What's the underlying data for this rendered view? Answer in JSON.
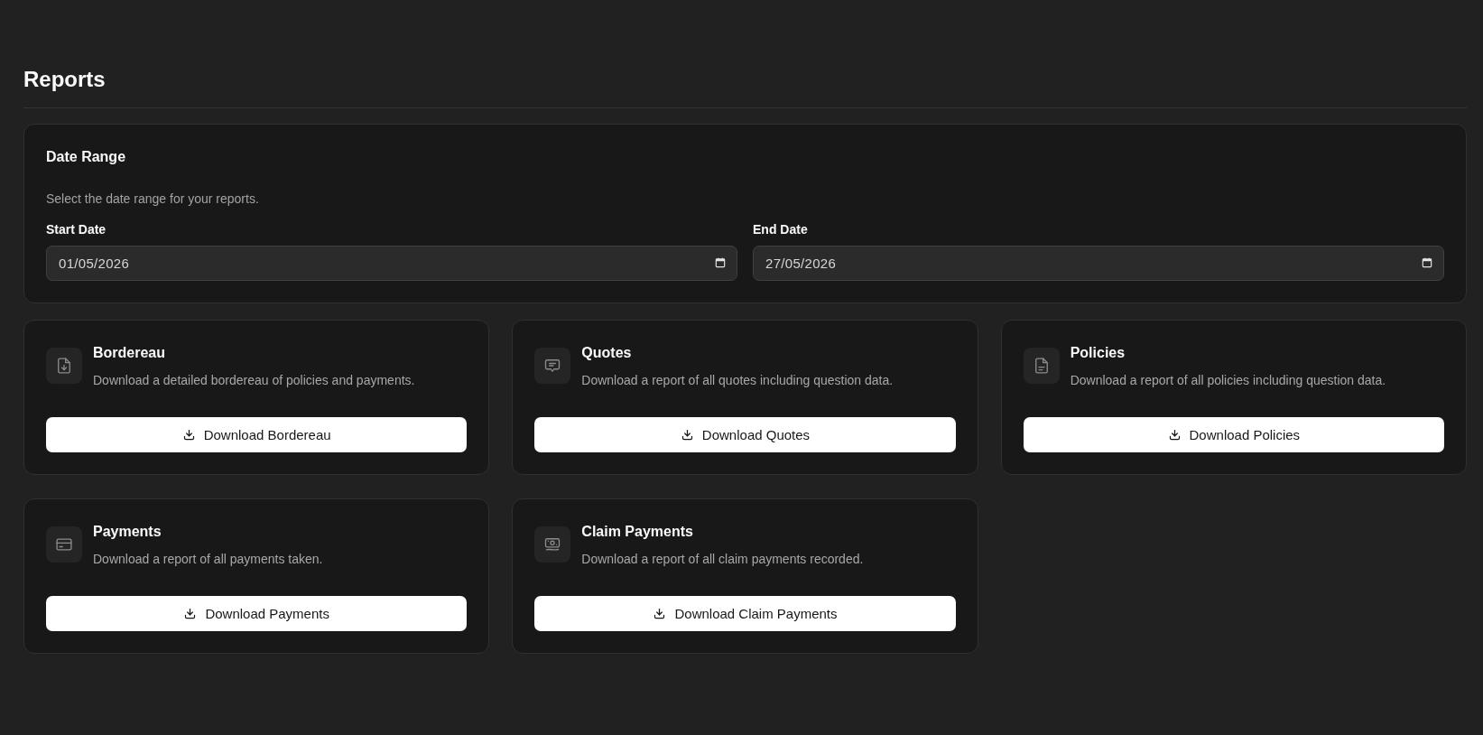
{
  "page": {
    "title": "Reports"
  },
  "date_range": {
    "title": "Date Range",
    "description": "Select the date range for your reports.",
    "fields": [
      {
        "label": "Start Date",
        "value": "01/05/2026"
      },
      {
        "label": "End Date",
        "value": "27/05/2026"
      }
    ]
  },
  "reports": [
    {
      "title": "Bordereau",
      "description": "Download a detailed bordereau of policies and payments.",
      "button": "Download Bordereau"
    },
    {
      "title": "Quotes",
      "description": "Download a report of all quotes including question data.",
      "button": "Download Quotes"
    },
    {
      "title": "Policies",
      "description": "Download a report of all policies including question data.",
      "button": "Download Policies"
    },
    {
      "title": "Payments",
      "description": "Download a report of all payments taken.",
      "button": "Download Payments"
    },
    {
      "title": "Claim Payments",
      "description": "Download a report of all claim payments recorded.",
      "button": "Download Claim Payments"
    }
  ]
}
